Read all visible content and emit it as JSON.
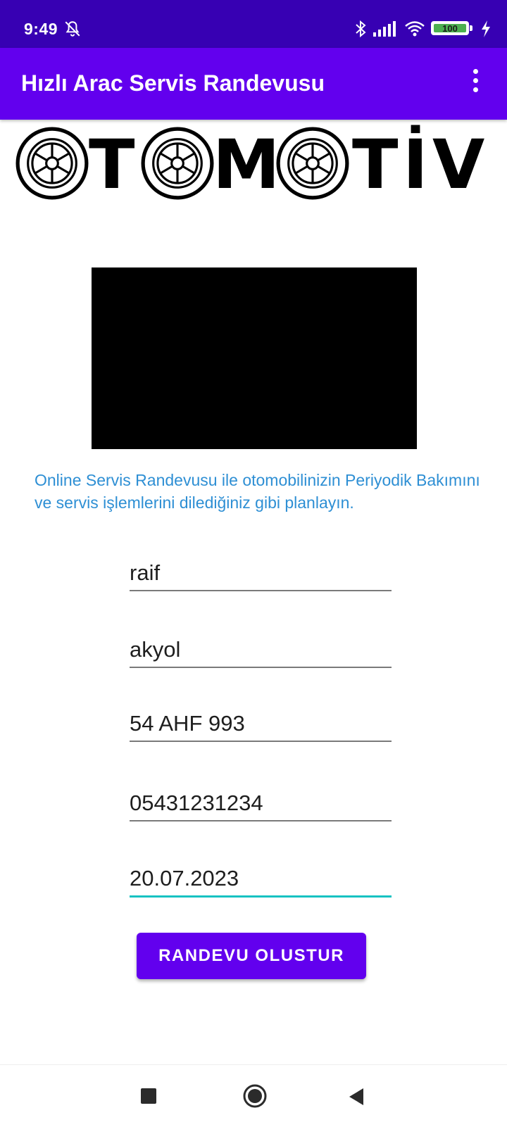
{
  "status_bar": {
    "time": "9:49",
    "battery": "100",
    "icons": [
      "notifications-off-icon",
      "bluetooth-icon",
      "signal-icon",
      "wifi-icon",
      "battery-icon",
      "charging-icon"
    ]
  },
  "app_bar": {
    "title": "Hızlı Arac Servis Randevusu",
    "overflow_icon": "more-vert-icon"
  },
  "logo": {
    "text": "OTOMOTİV",
    "icon": "wheel-icon"
  },
  "intro": {
    "text": "Online Servis Randevusu ile otomobilinizin Periyodik Bakımını ve servis işlemlerini dilediğiniz gibi planlayın."
  },
  "form": {
    "first_name": "raif",
    "last_name": "akyol",
    "plate": "54 AHF 993",
    "phone": "05431231234",
    "date": "20.07.2023",
    "submit_label": "RANDEVU OLUSTUR"
  },
  "nav_bar": {
    "buttons": [
      "recents-icon",
      "home-icon",
      "back-icon"
    ]
  },
  "colors": {
    "status_bar": "#3700b3",
    "app_bar": "#6200ee",
    "accent": "#17c2c2",
    "intro_text": "#2e8fd4",
    "button": "#6200ee"
  }
}
